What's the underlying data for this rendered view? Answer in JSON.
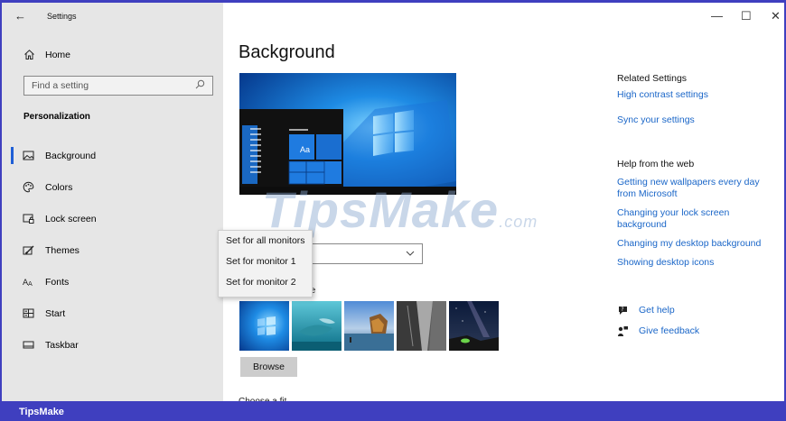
{
  "window": {
    "title": "Settings",
    "controls": {
      "minimize": "—",
      "maximize": "☐",
      "close": "✕"
    }
  },
  "sidebar": {
    "home_label": "Home",
    "search_placeholder": "Find a setting",
    "section_title": "Personalization",
    "items": [
      {
        "label": "Background",
        "icon": "image-icon",
        "selected": true
      },
      {
        "label": "Colors",
        "icon": "palette-icon",
        "selected": false
      },
      {
        "label": "Lock screen",
        "icon": "lock-screen-icon",
        "selected": false
      },
      {
        "label": "Themes",
        "icon": "brush-icon",
        "selected": false
      },
      {
        "label": "Fonts",
        "icon": "font-icon",
        "selected": false
      },
      {
        "label": "Start",
        "icon": "start-icon",
        "selected": false
      },
      {
        "label": "Taskbar",
        "icon": "taskbar-icon",
        "selected": false
      }
    ]
  },
  "main": {
    "title": "Background",
    "choose_picture_label": "re",
    "browse_label": "Browse",
    "choose_fit_label": "Choose a fit",
    "preview_tile_label": "Aa"
  },
  "context_menu": {
    "items": [
      "Set for all monitors",
      "Set for monitor 1",
      "Set for monitor 2"
    ]
  },
  "related": {
    "heading": "Related Settings",
    "links": [
      "High contrast settings",
      "Sync your settings"
    ]
  },
  "web_help": {
    "heading": "Help from the web",
    "links": [
      "Getting new wallpapers every day from Microsoft",
      "Changing your lock screen background",
      "Changing my desktop background",
      "Showing desktop icons"
    ]
  },
  "support": {
    "get_help": "Get help",
    "give_feedback": "Give feedback"
  },
  "watermark": {
    "main": "TipsMake",
    "suffix": ".com"
  },
  "footer": {
    "brand": "TipsMake"
  },
  "colors": {
    "accent": "#3f3fbf",
    "link": "#1a66c8",
    "sidebar": "#e6e6e6"
  }
}
